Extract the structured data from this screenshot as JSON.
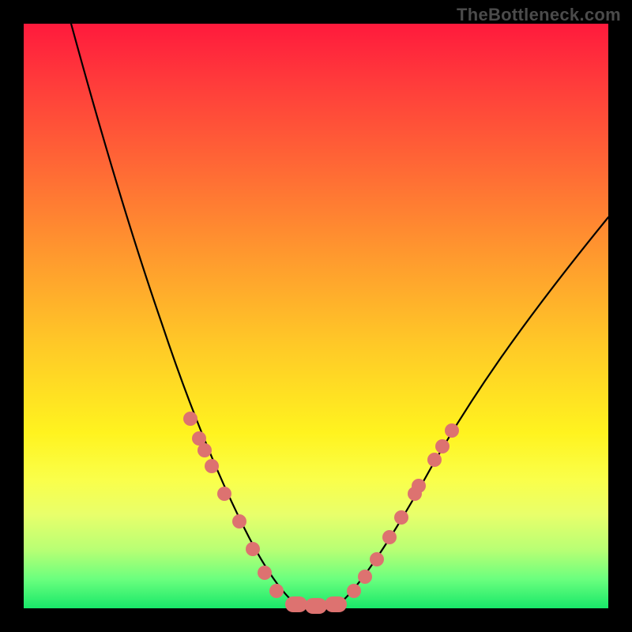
{
  "watermark": "TheBottleneck.com",
  "colors": {
    "marker": "#dd7270",
    "curve": "#000000",
    "gradient_top": "#ff1a3c",
    "gradient_mid": "#ffc927",
    "gradient_bottom": "#18e869"
  },
  "chart_data": {
    "type": "line",
    "title": "",
    "xlabel": "",
    "ylabel": "",
    "xlim": [
      0,
      100
    ],
    "ylim": [
      0,
      100
    ],
    "grid": false,
    "legend": false,
    "series": [
      {
        "name": "bottleneck-curve",
        "x": [
          5,
          10,
          15,
          20,
          25,
          30,
          35,
          40,
          42,
          44,
          46,
          48,
          50,
          55,
          60,
          65,
          70,
          75,
          80,
          85,
          90,
          95,
          100
        ],
        "y": [
          100,
          88,
          76,
          64,
          52,
          40,
          28,
          14,
          8,
          4,
          1,
          0,
          0,
          4,
          10,
          18,
          26,
          34,
          42,
          50,
          57,
          63,
          67
        ]
      }
    ],
    "markers": {
      "name": "highlighted-points",
      "curve": "bottleneck-curve",
      "x": [
        30,
        32,
        33,
        35,
        37,
        40,
        42,
        44,
        46,
        48,
        50,
        52,
        55,
        56,
        58,
        60,
        62,
        64,
        66
      ],
      "y": [
        40,
        36,
        34,
        28,
        22,
        14,
        8,
        4,
        1,
        0,
        0,
        1,
        4,
        6,
        8,
        10,
        14,
        18,
        22
      ]
    }
  }
}
